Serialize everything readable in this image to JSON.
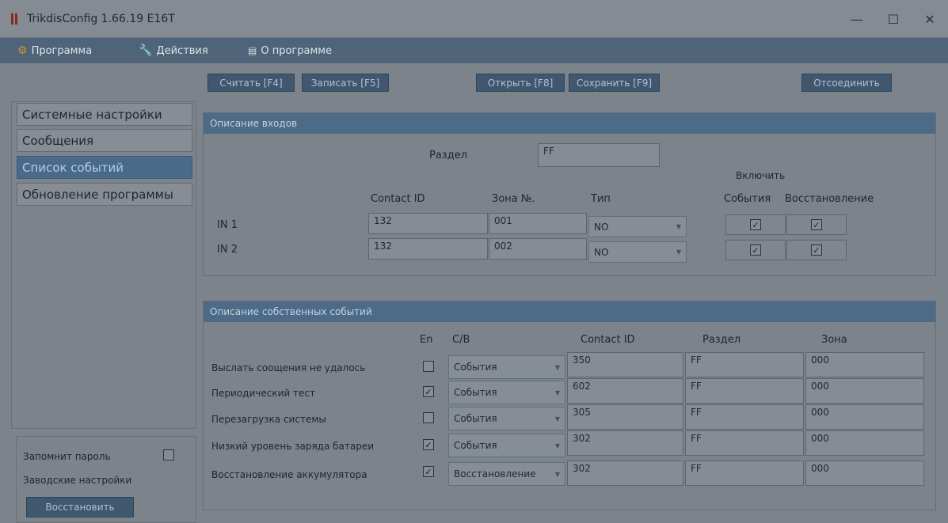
{
  "window": {
    "title": "TrikdisConfig 1.66.19   E16T",
    "minimize": "—",
    "maximize": "☐",
    "close": "✕"
  },
  "menu": [
    {
      "label": "Программа",
      "icon": "gear-icon"
    },
    {
      "label": "Действия",
      "icon": "wrench-icon"
    },
    {
      "label": "О программе",
      "icon": "book-icon"
    }
  ],
  "toolbar": {
    "read": "Считать [F4]",
    "write": "Записать [F5]",
    "open": "Открыть [F8]",
    "save": "Сохранить [F9]",
    "disconnect": "Отсоединить"
  },
  "sidebar": {
    "items": [
      {
        "label": "Системные настройки",
        "active": false
      },
      {
        "label": "Сообщения",
        "active": false
      },
      {
        "label": "Список событий",
        "active": true
      },
      {
        "label": "Обновление программы",
        "active": false
      }
    ]
  },
  "bottom_panel": {
    "remember_password": "Запомнит пароль",
    "remember_checked": false,
    "factory_settings": "Заводские настройки",
    "restore_button": "Восстановить"
  },
  "inputs_group": {
    "title": "Описание входов",
    "partition_label": "Раздел",
    "partition_value": "FF",
    "enable_label": "Включить",
    "columns": {
      "contact_id": "Contact ID",
      "zone": "Зона №.",
      "type": "Тип",
      "events": "События",
      "restore": "Восстановление"
    },
    "rows": [
      {
        "name": "IN 1",
        "contact_id": "132",
        "zone": "001",
        "type": "NO",
        "events": "✓",
        "restore": "✓"
      },
      {
        "name": "IN 2",
        "contact_id": "132",
        "zone": "002",
        "type": "NO",
        "events": "✓",
        "restore": "✓"
      }
    ]
  },
  "events_group": {
    "title": "Описание собственных событий",
    "columns": {
      "en": "En",
      "cb": "С/В",
      "contact_id": "Contact ID",
      "partition": "Раздел",
      "zone": "Зона"
    },
    "rows": [
      {
        "name": "Выслать соощения не удалось",
        "en": "",
        "type": "События",
        "contact_id": "350",
        "partition": "FF",
        "zone": "000"
      },
      {
        "name": "Периодический тест",
        "en": "✓",
        "type": "События",
        "contact_id": "602",
        "partition": "FF",
        "zone": "000"
      },
      {
        "name": "Перезагрузка системы",
        "en": "",
        "type": "События",
        "contact_id": "305",
        "partition": "FF",
        "zone": "000"
      },
      {
        "name": "Низкий уровень заряда батареи",
        "en": "✓",
        "type": "События",
        "contact_id": "302",
        "partition": "FF",
        "zone": "000"
      },
      {
        "name": "Восстановление аккумулятора",
        "en": "✓",
        "type": "Восстановление",
        "contact_id": "302",
        "partition": "FF",
        "zone": "000"
      }
    ]
  },
  "colors": {
    "accent": "#4d6a86",
    "menubar": "#4f6478",
    "active_item": "#4a6a8a",
    "button": "#40576d"
  }
}
